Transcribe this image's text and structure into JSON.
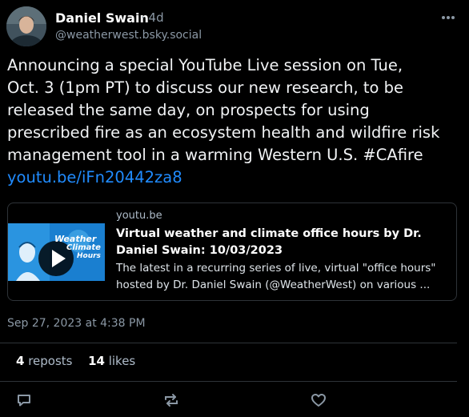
{
  "author": {
    "name": "Daniel Swain",
    "time": "· 4d",
    "handle": "@weatherwest.bsky.social"
  },
  "post": {
    "lines": [
      "Announcing a special YouTube Live session on Tue,",
      "Oct. 3 (1pm PT) to discuss our new research, to be",
      "released the same day, on prospects for using",
      "prescribed fire as an ecosystem health and wildfire risk",
      "management tool in a warming Western U.S. #CAfire"
    ],
    "link": "youtu.be/iFn20442za8"
  },
  "card": {
    "domain": "youtu.be",
    "title_lines": [
      "Virtual weather and climate office hours by Dr.",
      "Daniel Swain: 10/03/2023"
    ],
    "desc_lines": [
      "The latest in a recurring series of live, virtual \"office hours\"",
      "hosted by Dr. Daniel Swain (@WeatherWest) on various ..."
    ],
    "thumb_text": "Weather & Climate Office Hours"
  },
  "timestamp": "Sep 27, 2023 at 4:38 PM",
  "stats": {
    "reposts_count": "4",
    "reposts_label": "reposts",
    "likes_count": "14",
    "likes_label": "likes"
  },
  "icons": {
    "more": "more-options-icon",
    "reply": "reply-icon",
    "repost": "repost-icon",
    "like": "heart-icon",
    "play": "play-icon"
  },
  "colors": {
    "background": "#000000",
    "link": "#208bfe",
    "muted": "#8b98a5",
    "border": "#2e3338"
  }
}
